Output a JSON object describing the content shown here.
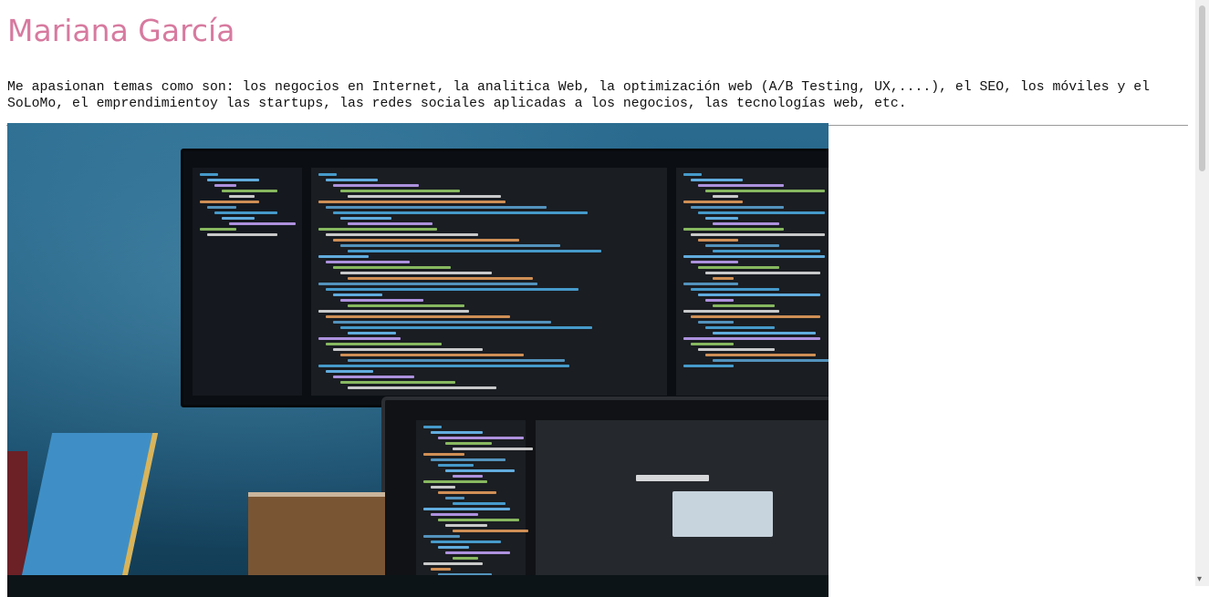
{
  "profile": {
    "name": "Mariana García",
    "bio": "Me apasionan temas como son: los negocios en Internet, la analitica Web, la optimización web (A/B Testing, UX,....), el SEO, los móviles y el SoLoMo, el emprendimientoy las startups, las redes sociales aplicadas a los negocios, las tecnologías web, etc."
  },
  "colors": {
    "name": "#d77a9f"
  }
}
